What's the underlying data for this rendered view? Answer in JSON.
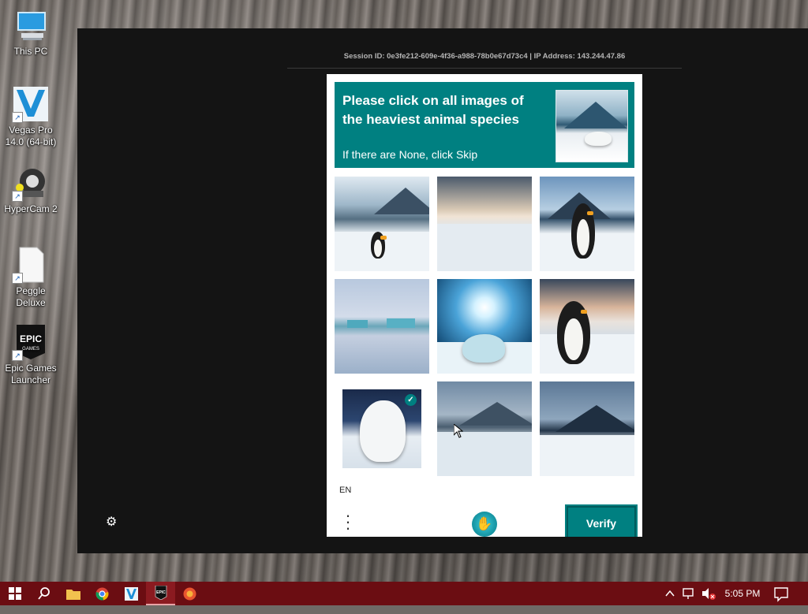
{
  "desktop": {
    "icons": [
      {
        "label": "This PC"
      },
      {
        "label": "Vegas Pro 14.0 (64-bit)"
      },
      {
        "label": "HyperCam 2"
      },
      {
        "label": "Peggle Deluxe"
      },
      {
        "label": "Epic Games Launcher"
      }
    ]
  },
  "window": {
    "session_info": "Session ID: 0e3fe212-609e-4f36-a988-78b0e67d73c4 | IP Address: 143.244.47.86"
  },
  "captcha": {
    "prompt_title": "Please click on all images of the heaviest animal species",
    "prompt_sub": "If there are None, click Skip",
    "language": "EN",
    "verify_label": "Verify",
    "accent_color": "#008081",
    "tiles": [
      {
        "subject": "penguin on snowy mountain",
        "selected": false
      },
      {
        "subject": "snowy landscape at sunset",
        "selected": false
      },
      {
        "subject": "penguin with mountains",
        "selected": false
      },
      {
        "subject": "ice field with icebergs",
        "selected": false
      },
      {
        "subject": "polar bear under starburst",
        "selected": false
      },
      {
        "subject": "penguin at sunset",
        "selected": false
      },
      {
        "subject": "polar bear",
        "selected": true
      },
      {
        "subject": "mountain snowfield",
        "selected": false
      },
      {
        "subject": "dark mountain snowfield",
        "selected": false
      }
    ]
  },
  "taskbar": {
    "time": "5:05 PM",
    "taskbar_color": "#6b0d12"
  }
}
